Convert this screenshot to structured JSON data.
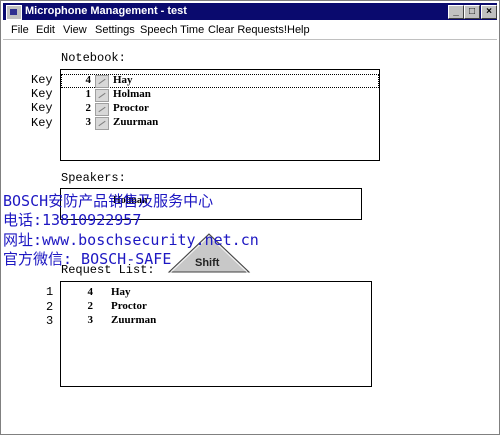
{
  "window": {
    "title": "Microphone Management - test",
    "buttons": {
      "minimize": "_",
      "maximize": "□",
      "close": "×"
    }
  },
  "menu": [
    "File",
    "Edit",
    "View",
    "Settings",
    "Speech Time",
    "Clear Requests!",
    "Help"
  ],
  "notebook": {
    "label": "Notebook:",
    "key_label": "Key",
    "rows": [
      {
        "num": "4",
        "name": "Hay"
      },
      {
        "num": "1",
        "name": "Holman"
      },
      {
        "num": "2",
        "name": "Proctor"
      },
      {
        "num": "3",
        "name": "Zuurman"
      }
    ]
  },
  "speakers": {
    "label": "Speakers:",
    "current": "Holman"
  },
  "request_list": {
    "label": "Request List:",
    "positions": [
      "1",
      "2",
      "3"
    ],
    "rows": [
      {
        "num": "4",
        "name": "Hay"
      },
      {
        "num": "2",
        "name": "Proctor"
      },
      {
        "num": "3",
        "name": "Zuurman"
      }
    ]
  },
  "shift_button": {
    "label": "Shift"
  },
  "watermark": [
    "BOSCH安防产品销售及服务中心",
    "电话:13810922957",
    "网址:www.boschsecurity.net.cn",
    "官方微信: BOSCH-SAFE"
  ],
  "colors": {
    "titlebar": "#0a0a6e",
    "watermark": "#1d17c2"
  }
}
